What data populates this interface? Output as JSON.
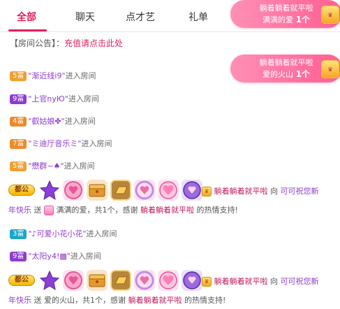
{
  "tabs": [
    {
      "label": "全部",
      "active": true
    },
    {
      "label": "聊天",
      "active": false
    },
    {
      "label": "点才艺",
      "active": false
    },
    {
      "label": "礼单",
      "active": false
    }
  ],
  "banners": [
    {
      "line1": "躺着躺着就平啦",
      "line2_prefix": "满满的爱",
      "line2_count": "1个"
    },
    {
      "line1": "躺着躺着就平啦",
      "line2_prefix": "爱的火山",
      "line2_count": "1个"
    }
  ],
  "notice": {
    "label": "【房间公告】：",
    "link": "充值请点击此处"
  },
  "entries": [
    {
      "rank": "5富",
      "rank_class": "rank-5",
      "nick": "\"渐近线i9\"",
      "action": "进入房间"
    },
    {
      "rank": "9富",
      "rank_class": "rank-9",
      "nick": "\"上官nyЮ\"",
      "action": "进入房间"
    },
    {
      "rank": "4富",
      "rank_class": "rank-4",
      "nick": "\"叡姑娘✤\"",
      "action": "进入房间"
    },
    {
      "rank": "7富",
      "rank_class": "rank-7",
      "nick": "\"ミ迪厅音乐ミ\"",
      "action": "进入房间"
    },
    {
      "rank": "5富",
      "rank_class": "rank-5",
      "nick": "\"懋群~♠\"",
      "action": "进入房间"
    },
    {
      "rank": "3富",
      "rank_class": "rank-3",
      "nick": "\"♪可爱小花小花\"",
      "action": "进入房间"
    },
    {
      "rank": "9富",
      "rank_class": "rank-9",
      "nick": "\"太阳y4!▩\"",
      "action": "进入房间"
    }
  ],
  "gift_msgs": [
    {
      "vip": "都公",
      "sender": "躺着躺着就平啦",
      "to": "向",
      "receiver": "可可祝您新",
      "cont": "年快乐",
      "send": "送",
      "gift": "满满的爱，共1个，感谢",
      "thanks_name": "躺着躺着就平啦",
      "thanks_tail": "的热情支持!"
    },
    {
      "vip": "都公",
      "sender": "躺着躺着就平啦",
      "to": "向",
      "receiver": "可可祝您新",
      "cont": "年快乐",
      "send": "送",
      "gift": "爱的火山，共1个，感谢",
      "thanks_name": "躺着躺着就平啦",
      "thanks_tail": "的热情支持!"
    }
  ],
  "small_icon": "gift-box-icon",
  "colors": {
    "accent": "#e2215c",
    "nick": "#8e3bd1",
    "banner": "#ff5f92"
  }
}
